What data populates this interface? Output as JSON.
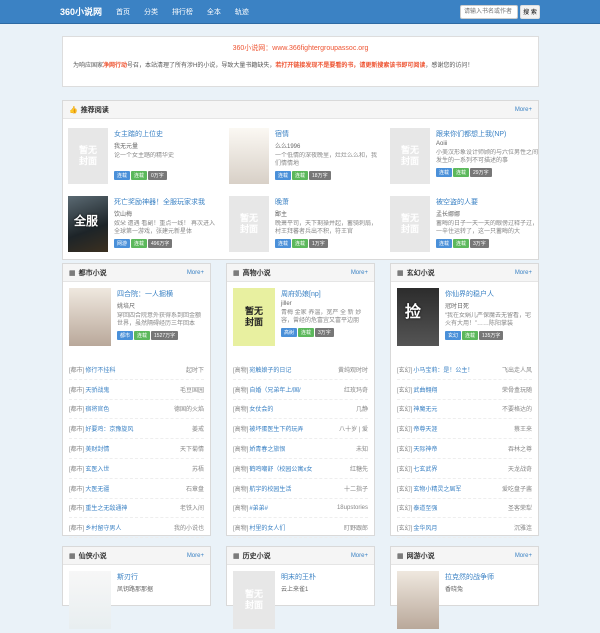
{
  "header": {
    "logo": "360小说网",
    "nav": [
      "首页",
      "分类",
      "排行榜",
      "全本",
      "轨迹"
    ],
    "search_placeholder": "请输入书名或作者",
    "search_button": "搜 索"
  },
  "notice": {
    "title": "360小说网：www.366fightergroupassoc.org",
    "text_a": "为响应国家",
    "text_red1": "净网行动",
    "text_b": "号召，本站清理了所有涉H的小说，导致大量书籍缺失，",
    "text_red2": "若打开链接发现不是要看的书，请更新搜索该书即可阅读",
    "text_c": "，感谢您的访问！"
  },
  "rec": {
    "title": "推荐阅读",
    "more": "More+",
    "items": [
      {
        "title": "女主踏的上位史",
        "author": "我无元量",
        "desc": "论一个女主踏的精华史",
        "tags": [
          "连载",
          "连载",
          "0万字"
        ]
      },
      {
        "title": "宿情",
        "author": "么么1996",
        "desc": "一个低情的深夜晚里，灶灶么么和，我们情情地",
        "tags": [
          "连载",
          "连载",
          "18万字"
        ]
      },
      {
        "title": "跟来你们都想上我(NP)",
        "author": "Aoiii",
        "desc": "小美汉形象设计师顾的与六位男性之间发生的一系列不可描述的事",
        "tags": [
          "连载",
          "连载",
          "29万字"
        ]
      },
      {
        "title": "死亡奖励神器！全服玩家求我",
        "author": "饮山梅",
        "desc": "奴朵 遭遇 看副！重点一线！ 再次进入 全球第一游戏，张建元新星体",
        "tags": [
          "网游",
          "连载",
          "496万字"
        ]
      },
      {
        "title": "晚萧",
        "author": "鄙主",
        "desc": "晚萧平司，天下剩操并起，蓄骑刺扇，村王拜蕃者兵出不积，符王官",
        "tags": [
          "连载",
          "连载",
          "1万字"
        ]
      },
      {
        "title": "被空盗的人要",
        "author": "孟长娜娜",
        "desc": "蓄晦的日子一天一天的眼傍过释子过，一辛住运转了，这一只蓄晦的大",
        "tags": [
          "连载",
          "连载",
          "3万字"
        ]
      }
    ]
  },
  "cats": [
    {
      "title": "都市小说",
      "more": "More+",
      "top": {
        "title": "四合院：一人掘横",
        "author": "姚培尺",
        "desc": "穿回四合院意外获得系到回金额世界，虽然隔碍经历三年回本",
        "tags": [
          "都市",
          "连载",
          "1527万字"
        ]
      },
      "list": [
        [
          "[都市]",
          "修行不挂科",
          "起时下"
        ],
        [
          "[都市]",
          "天骄战鬼",
          "毛豆国园"
        ],
        [
          "[都市]",
          "宿将官色",
          "德国的火焰"
        ],
        [
          "[都市]",
          "好要鸡：京豫旋风",
          "姜戒"
        ],
        [
          "[都市]",
          "美财封情",
          "天下菊情"
        ],
        [
          "[都市]",
          "玄医入世",
          "苏梧"
        ],
        [
          "[都市]",
          "大医无疆",
          "石章盘"
        ],
        [
          "[都市]",
          "重生之无敌通神",
          "老铁入间"
        ],
        [
          "[都市]",
          "乡村留守男人",
          "我的小说也"
        ]
      ]
    },
    {
      "title": "高物小说",
      "more": "More+",
      "top": {
        "title": "周府奶娘[np]",
        "author": "jiller",
        "desc": "青梅 金家 养温，宽严 全 新 妙 容，曾经的危富宜又富平边朋",
        "tags": [
          "高树",
          "连载",
          "3万字"
        ]
      },
      "list": [
        [
          "[高物]",
          "宛触娘子的日记",
          "黄纯观时时"
        ],
        [
          "[高物]",
          "自婚（兄弟年上/国/",
          "红玫玛奇"
        ],
        [
          "[高物]",
          "女仗会的",
          "几静"
        ],
        [
          "[高物]",
          "被坏蛋医生下药玩弄",
          "八十岁 | 爱"
        ],
        [
          "[高物]",
          "娇青春之旅恨",
          "未知"
        ],
        [
          "[高物]",
          "鹤鸣嘲舒（校园公寓x女",
          "红糖先"
        ],
        [
          "[高物]",
          "航宇的校园生活",
          "十二指子"
        ],
        [
          "[高物]",
          "#弟弟#",
          "18upstories"
        ],
        [
          "[高物]",
          "村里的女人们",
          "盯野跟郎"
        ]
      ]
    },
    {
      "title": "玄幻小说",
      "more": "More+",
      "top": {
        "title": "你仙界的稳户人",
        "author": "冠时日死",
        "desc": "“我在女娲儿严保魔去无留看，宅火有大用！”……陈阳掌装",
        "tags": [
          "玄幻",
          "连载",
          "135万字"
        ]
      },
      "list": [
        [
          "[玄幻]",
          "小马宝莉：是！公主！",
          "飞出走人风"
        ],
        [
          "[玄幻]",
          "武曲翱翔",
          "荣骨盒玩随"
        ],
        [
          "[玄幻]",
          "神魔无元",
          "不要格达的"
        ],
        [
          "[玄幻]",
          "帝尊天涯",
          "蔡王来"
        ],
        [
          "[玄幻]",
          "天际神帝",
          "吞林之尊"
        ],
        [
          "[玄幻]",
          "七玄武界",
          "天龙战奇"
        ],
        [
          "[玄幻]",
          "玄物小精灵之屆军",
          "爱吃盘子酱"
        ],
        [
          "[玄幻]",
          "泰道至强",
          "圣客荣犁"
        ],
        [
          "[玄幻]",
          "金华风月",
          "沉雅连"
        ]
      ]
    }
  ],
  "cats2": [
    {
      "title": "仙侠小说",
      "more": "More+",
      "top": {
        "title": "斯刃行",
        "author": "凤钥路那那据"
      }
    },
    {
      "title": "历史小说",
      "more": "More+",
      "top": {
        "title": "明末的王朴",
        "author": "云上来雀1"
      }
    },
    {
      "title": "网游小说",
      "more": "More+",
      "top": {
        "title": "拉克然的战争师",
        "author": "香晓兔"
      }
    }
  ]
}
